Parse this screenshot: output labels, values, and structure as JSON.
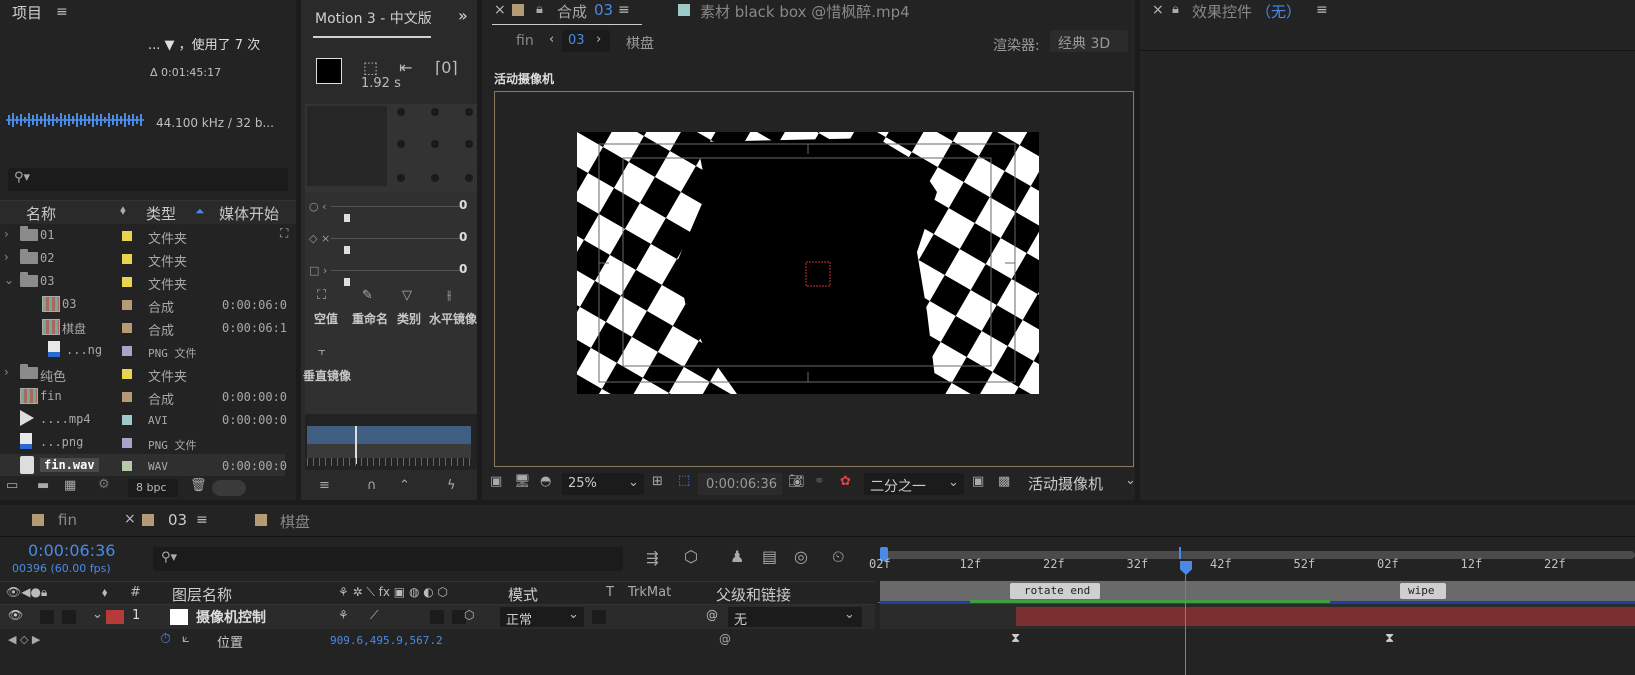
{
  "project": {
    "title": "项目",
    "usage": "... ▼ ，使用了 7 次",
    "delta": "Δ 0:01:45:17",
    "audio_info": "44.100 kHz / 32 b...",
    "columns": {
      "name": "名称",
      "type": "类型",
      "media_start": "媒体开始"
    },
    "items": [
      {
        "name": "01",
        "type": "文件夹",
        "start": "",
        "color": "#e8d44d",
        "kind": "folder",
        "expand": "›"
      },
      {
        "name": "02",
        "type": "文件夹",
        "start": "",
        "color": "#e8d44d",
        "kind": "folder",
        "expand": "›"
      },
      {
        "name": "03",
        "type": "文件夹",
        "start": "",
        "color": "#e8d44d",
        "kind": "folder",
        "expand": "⌄"
      },
      {
        "name": "03",
        "type": "合成",
        "start": "0:00:06:0",
        "color": "#b49b76",
        "kind": "comp"
      },
      {
        "name": "棋盘",
        "type": "合成",
        "start": "0:00:06:1",
        "color": "#b49b76",
        "kind": "comp"
      },
      {
        "name": "...ng",
        "type": "PNG 文件",
        "start": "",
        "color": "#a9a3c8",
        "kind": "file"
      },
      {
        "name": "纯色",
        "type": "文件夹",
        "start": "",
        "color": "#e8d44d",
        "kind": "folder",
        "expand": "›"
      },
      {
        "name": "fin",
        "type": "合成",
        "start": "0:00:00:0",
        "color": "#b49b76",
        "kind": "comp"
      },
      {
        "name": "....mp4",
        "type": "AVI",
        "start": "0:00:00:0",
        "color": "#9fc8c8",
        "kind": "video"
      },
      {
        "name": "...png",
        "type": "PNG 文件",
        "start": "",
        "color": "#a9a3c8",
        "kind": "file"
      },
      {
        "name": "fin.wav",
        "type": "WAV",
        "start": "0:00:00:0",
        "color": "#b8c9a8",
        "kind": "audio"
      }
    ],
    "bpc": "8 bpc"
  },
  "motion": {
    "title": "Motion 3 - 中文版",
    "duration": "1.92 s",
    "sliders": [
      "0",
      "0",
      "0"
    ],
    "buttons": [
      "空值",
      "重命名",
      "类别",
      "水平镜像",
      "垂直镜像"
    ]
  },
  "comp": {
    "tab": "合成",
    "tab_num": "03",
    "footage_tab": "素材 black box @惜枫醉.mp4",
    "nav_fin": "fin",
    "nav_current": "03",
    "nav_next": "棋盘",
    "renderer_label": "渲染器:",
    "renderer_value": "经典 3D",
    "camera_label": "活动摄像机",
    "zoom": "25%",
    "timecode": "0:00:06:36",
    "resolution": "二分之一",
    "view": "活动摄像机"
  },
  "effects": {
    "title": "效果控件",
    "none": "（无）"
  },
  "timeline": {
    "tabs": [
      "fin",
      "03",
      "棋盘"
    ],
    "timecode": "0:00:06:36",
    "frames": "00396 (60.00 fps)",
    "columns": {
      "layer_name": "图层名称",
      "mode": "模式",
      "t": "T",
      "trkmat": "TrkMat",
      "parent": "父级和链接",
      "num": "#"
    },
    "layer": {
      "num": "1",
      "name": "摄像机控制",
      "mode": "正常",
      "parent": "无"
    },
    "position_label": "位置",
    "position_value": "909.6,495.9,567.2",
    "ruler": [
      "02f",
      "12f",
      "22f",
      "32f",
      "42f",
      "52f",
      "02f",
      "12f",
      "22f"
    ],
    "markers": [
      "rotate end",
      "wipe"
    ]
  }
}
